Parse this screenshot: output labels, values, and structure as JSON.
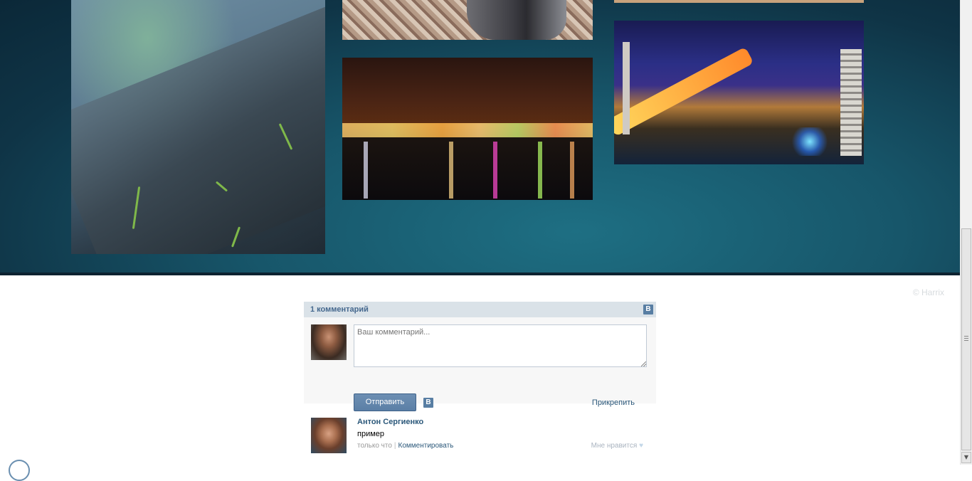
{
  "gallery": {
    "photos": [
      {
        "name": "grass-closeup"
      },
      {
        "name": "fabric-portrait"
      },
      {
        "name": "river-night-city"
      },
      {
        "name": "bridge-night-city"
      }
    ]
  },
  "footer": {
    "copyright": "© Harrix"
  },
  "comments_widget": {
    "count_label": "1 комментарий",
    "logo_text": "B",
    "input": {
      "placeholder": "Ваш комментарий...",
      "value": ""
    },
    "send_label": "Отправить",
    "attach_label": "Прикрепить",
    "comments": [
      {
        "author": "Антон Сергиенко",
        "text": "пример",
        "time": "только что",
        "separator": "|",
        "reply_label": "Комментировать",
        "like_label": "Мне нравится",
        "like_icon": "♥"
      }
    ]
  },
  "colors": {
    "gallery_bg": "#17566a",
    "vk_header": "#dae2e8",
    "vk_link": "#2b587a",
    "vk_button": "#5b7fa6"
  }
}
